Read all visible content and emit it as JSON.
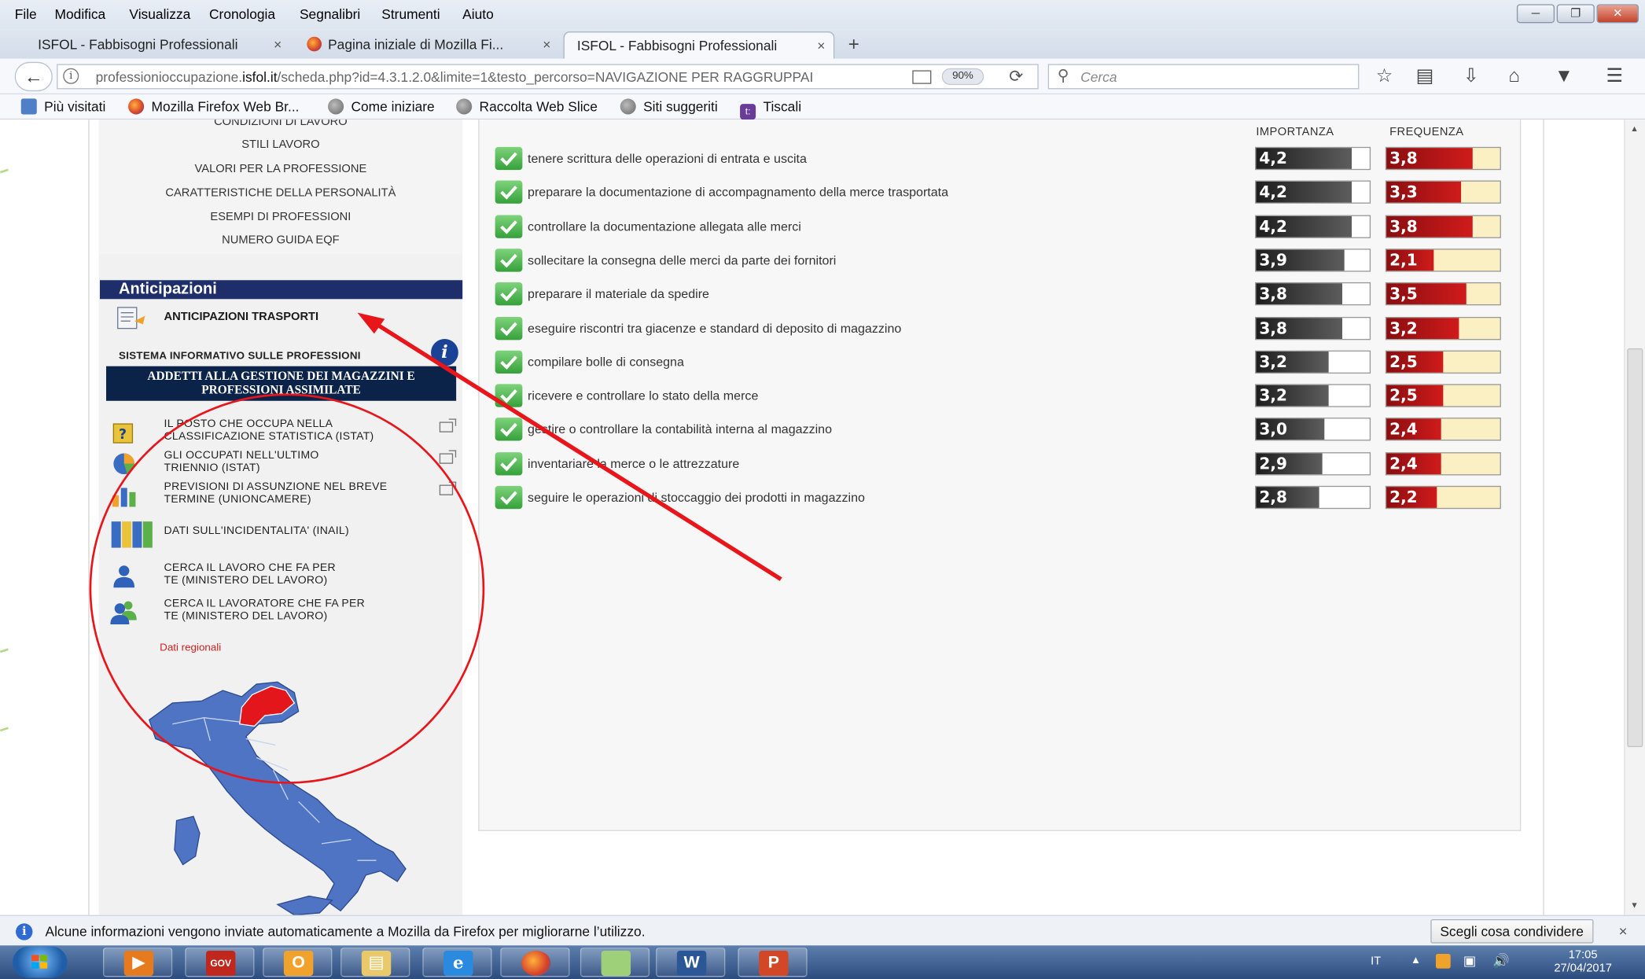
{
  "window": {
    "menu": [
      "File",
      "Modifica",
      "Visualizza",
      "Cronologia",
      "Segnalibri",
      "Strumenti",
      "Aiuto"
    ],
    "tabs": [
      {
        "label": "ISFOL - Fabbisogni Professionali",
        "active": false
      },
      {
        "label": "Pagina iniziale di Mozilla Fi...",
        "active": false
      },
      {
        "label": "ISFOL - Fabbisogni Professionali",
        "active": true
      }
    ],
    "new_tab": "+",
    "close_x": "×"
  },
  "navbar": {
    "url_prefix": "professionioccupazione.",
    "url_domain": "isfol.it",
    "url_rest": "/scheda.php?id=4.3.1.2.0&limite=1&testo_percorso=NAVIGAZIONE PER RAGGRUPPAI",
    "zoom": "90%",
    "search_placeholder": "Cerca",
    "icons": [
      "back-arrow-icon",
      "info-icon",
      "reader-view-icon",
      "reload-icon",
      "search-icon",
      "bookmark-star-icon",
      "library-icon",
      "download-icon",
      "home-icon",
      "pocket-icon",
      "hamburger-menu-icon"
    ]
  },
  "bookmarks": [
    "Più visitati",
    "Mozilla Firefox Web Br...",
    "Come iniziare",
    "Raccolta Web Slice",
    "Siti suggeriti",
    "Tiscali"
  ],
  "sidebar": {
    "links": [
      "CONDIZIONI DI LAVORO",
      "STILI LAVORO",
      "VALORI PER LA PROFESSIONE",
      "CARATTERISTICHE DELLA PERSONALITÀ",
      "ESEMPI DI PROFESSIONI",
      "NUMERO GUIDA EQF"
    ],
    "anticipazioni_title": "Anticipazioni",
    "anticipazioni_item": "ANTICIPAZIONI TRASPORTI",
    "sip_label": "SISTEMA INFORMATIVO SULLE PROFESSIONI",
    "info_glyph": "i",
    "profession_line1": "ADDETTI ALLA GESTIONE DEI MAGAZZINI E",
    "profession_line2": "PROFESSIONI ASSIMILATE",
    "resources": [
      {
        "line1": "IL POSTO CHE OCCUPA NELLA",
        "line2": "CLASSIFICAZIONE STATISTICA (ISTAT)",
        "icon": "question-doc-icon",
        "external": true
      },
      {
        "line1": "GLI OCCUPATI NELL'ULTIMO",
        "line2": "TRIENNIO (ISTAT)",
        "icon": "pie-chart-icon",
        "external": true
      },
      {
        "line1": "PREVISIONI DI ASSUNZIONE NEL BREVE",
        "line2": "TERMINE (UNIONCAMERE)",
        "icon": "bar-chart-icon",
        "external": true
      },
      {
        "line1": "DATI SULL'INCIDENTALITA' (INAIL)",
        "line2": "",
        "icon": "binders-icon",
        "external": false
      },
      {
        "line1": "CERCA IL LAVORO CHE FA PER",
        "line2": "TE (MINISTERO DEL LAVORO)",
        "icon": "person-icon",
        "external": false
      },
      {
        "line1": "CERCA IL LAVORATORE CHE FA PER",
        "line2": "TE (MINISTERO DEL LAVORO)",
        "icon": "people-icon",
        "external": false
      }
    ],
    "dati_regionali": "Dati regionali",
    "map_highlight_color": "#e3161b",
    "map_color": "#4f74c4"
  },
  "activities": {
    "col_importanza": "IMPORTANZA",
    "col_frequenza": "FREQUENZA",
    "scale_max": 5,
    "rows": [
      {
        "label": "tenere scrittura delle operazioni di entrata e uscita",
        "importanza": "4,2",
        "imp_value": 4.2,
        "frequenza": "3,8",
        "freq_value": 3.8
      },
      {
        "label": "preparare la documentazione di accompagnamento della merce trasportata",
        "importanza": "4,2",
        "imp_value": 4.2,
        "frequenza": "3,3",
        "freq_value": 3.3
      },
      {
        "label": "controllare la documentazione allegata alle merci",
        "importanza": "4,2",
        "imp_value": 4.2,
        "frequenza": "3,8",
        "freq_value": 3.8
      },
      {
        "label": "sollecitare la consegna delle merci da parte dei fornitori",
        "importanza": "3,9",
        "imp_value": 3.9,
        "frequenza": "2,1",
        "freq_value": 2.1
      },
      {
        "label": "preparare il materiale da spedire",
        "importanza": "3,8",
        "imp_value": 3.8,
        "frequenza": "3,5",
        "freq_value": 3.5
      },
      {
        "label": "eseguire riscontri tra giacenze e standard di deposito di magazzino",
        "importanza": "3,8",
        "imp_value": 3.8,
        "frequenza": "3,2",
        "freq_value": 3.2
      },
      {
        "label": "compilare bolle di consegna",
        "importanza": "3,2",
        "imp_value": 3.2,
        "frequenza": "2,5",
        "freq_value": 2.5
      },
      {
        "label": "ricevere e controllare lo stato della merce",
        "importanza": "3,2",
        "imp_value": 3.2,
        "frequenza": "2,5",
        "freq_value": 2.5
      },
      {
        "label": "gestire o controllare la contabilità interna al magazzino",
        "importanza": "3,0",
        "imp_value": 3.0,
        "frequenza": "2,4",
        "freq_value": 2.4
      },
      {
        "label": "inventariare la merce o le attrezzature",
        "importanza": "2,9",
        "imp_value": 2.9,
        "frequenza": "2,4",
        "freq_value": 2.4
      },
      {
        "label": "seguire le operazioni di stoccaggio dei prodotti in magazzino",
        "importanza": "2,8",
        "imp_value": 2.8,
        "frequenza": "2,2",
        "freq_value": 2.2
      }
    ]
  },
  "annotation_color": "#e8151b",
  "notification": {
    "message": "Alcune informazioni vengono inviate automaticamente a Mozilla da Firefox per migliorarne l’utilizzo.",
    "button": "Scegli cosa condividere",
    "close": "×"
  },
  "taskbar": {
    "apps": [
      "media-player-icon",
      "team-gov-icon",
      "outlook-icon",
      "file-explorer-icon",
      "internet-explorer-icon",
      "firefox-icon",
      "generic-app-icon",
      "word-icon",
      "powerpoint-icon"
    ],
    "language": "IT",
    "time": "17:05",
    "date": "27/04/2017"
  }
}
